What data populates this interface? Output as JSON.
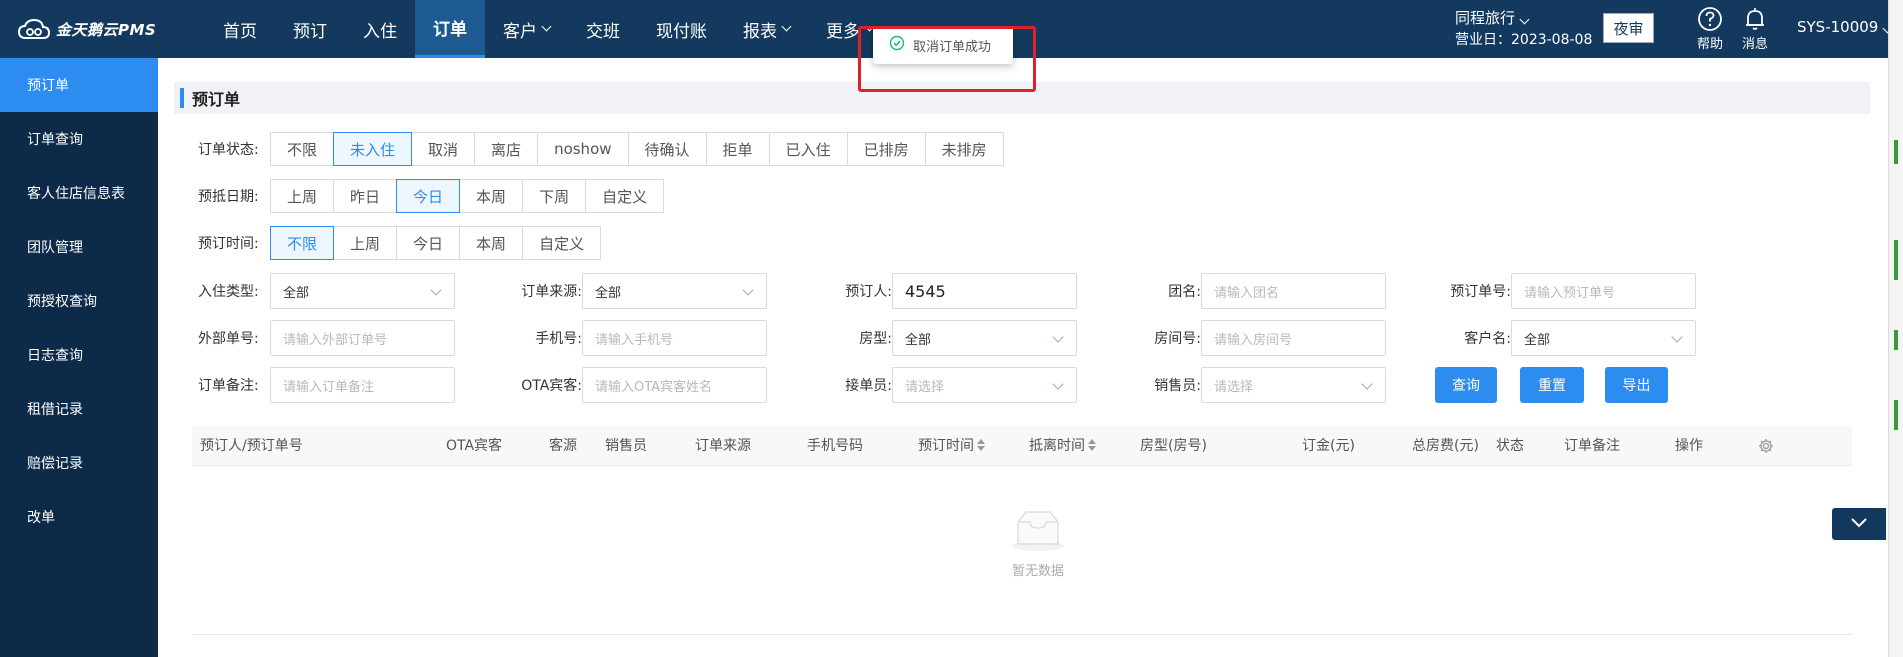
{
  "brand": {
    "name": "金天鹅云PMS"
  },
  "nav": [
    {
      "label": "首页",
      "dropdown": false,
      "active": false
    },
    {
      "label": "预订",
      "dropdown": false,
      "active": false
    },
    {
      "label": "入住",
      "dropdown": false,
      "active": false
    },
    {
      "label": "订单",
      "dropdown": false,
      "active": true
    },
    {
      "label": "客户",
      "dropdown": true,
      "active": false
    },
    {
      "label": "交班",
      "dropdown": false,
      "active": false
    },
    {
      "label": "现付账",
      "dropdown": false,
      "active": false
    },
    {
      "label": "报表",
      "dropdown": true,
      "active": false
    },
    {
      "label": "更多",
      "dropdown": true,
      "active": false
    }
  ],
  "header": {
    "hotel": "同程旅行",
    "business_day": "营业日：2023-08-08",
    "night_audit": "夜审",
    "help": "帮助",
    "messages": "消息",
    "user": "SYS-10009"
  },
  "sidebar": [
    {
      "label": "预订单",
      "active": true
    },
    {
      "label": "订单查询",
      "active": false
    },
    {
      "label": "客人住店信息表",
      "active": false
    },
    {
      "label": "团队管理",
      "active": false
    },
    {
      "label": "预授权查询",
      "active": false
    },
    {
      "label": "日志查询",
      "active": false
    },
    {
      "label": "租借记录",
      "active": false
    },
    {
      "label": "赔偿记录",
      "active": false
    },
    {
      "label": "改单",
      "active": false
    }
  ],
  "page": {
    "title": "预订单"
  },
  "filters": {
    "order_status": {
      "label": "订单状态:",
      "options": [
        "不限",
        "未入住",
        "取消",
        "离店",
        "noshow",
        "待确认",
        "拒单",
        "已入住",
        "已排房",
        "未排房"
      ],
      "selected": "未入住"
    },
    "arrival_date": {
      "label": "预抵日期:",
      "options": [
        "上周",
        "昨日",
        "今日",
        "本周",
        "下周",
        "自定义"
      ],
      "selected": "今日"
    },
    "booking_time": {
      "label": "预订时间:",
      "options": [
        "不限",
        "上周",
        "今日",
        "本周",
        "自定义"
      ],
      "selected": "不限"
    }
  },
  "form": {
    "checkin_type": {
      "label": "入住类型:",
      "value": "全部"
    },
    "order_source": {
      "label": "订单来源:",
      "value": "全部"
    },
    "booker": {
      "label": "预订人:",
      "value": "4545"
    },
    "group_name": {
      "label": "团名:",
      "placeholder": "请输入团名"
    },
    "booking_no": {
      "label": "预订单号:",
      "placeholder": "请输入预订单号"
    },
    "external_no": {
      "label": "外部单号:",
      "placeholder": "请输入外部订单号"
    },
    "phone": {
      "label": "手机号:",
      "placeholder": "请输入手机号"
    },
    "room_type": {
      "label": "房型:",
      "value": "全部"
    },
    "room_no": {
      "label": "房间号:",
      "placeholder": "请输入房间号"
    },
    "customer": {
      "label": "客户名:",
      "value": "全部"
    },
    "remark": {
      "label": "订单备注:",
      "placeholder": "请输入订单备注"
    },
    "ota_guest": {
      "label": "OTA宾客:",
      "placeholder": "请输入OTA宾客姓名"
    },
    "receiver": {
      "label": "接单员:",
      "placeholder": "请选择"
    },
    "salesperson": {
      "label": "销售员:",
      "placeholder": "请选择"
    }
  },
  "actions": {
    "query": "查询",
    "reset": "重置",
    "export": "导出"
  },
  "table": {
    "columns": [
      "预订人/预订单号",
      "OTA宾客",
      "客源",
      "销售员",
      "订单来源",
      "手机号码",
      "预订时间",
      "抵离时间",
      "房型(房号)",
      "订金(元)",
      "总房费(元)",
      "状态",
      "订单备注",
      "操作"
    ],
    "empty_text": "暂无数据"
  },
  "toast": {
    "message": "取消订单成功"
  },
  "colors": {
    "topbar": "#133a5e",
    "sidebar": "#0d2a48",
    "accent": "#2d8cf0",
    "highlight": "#e2202a"
  }
}
